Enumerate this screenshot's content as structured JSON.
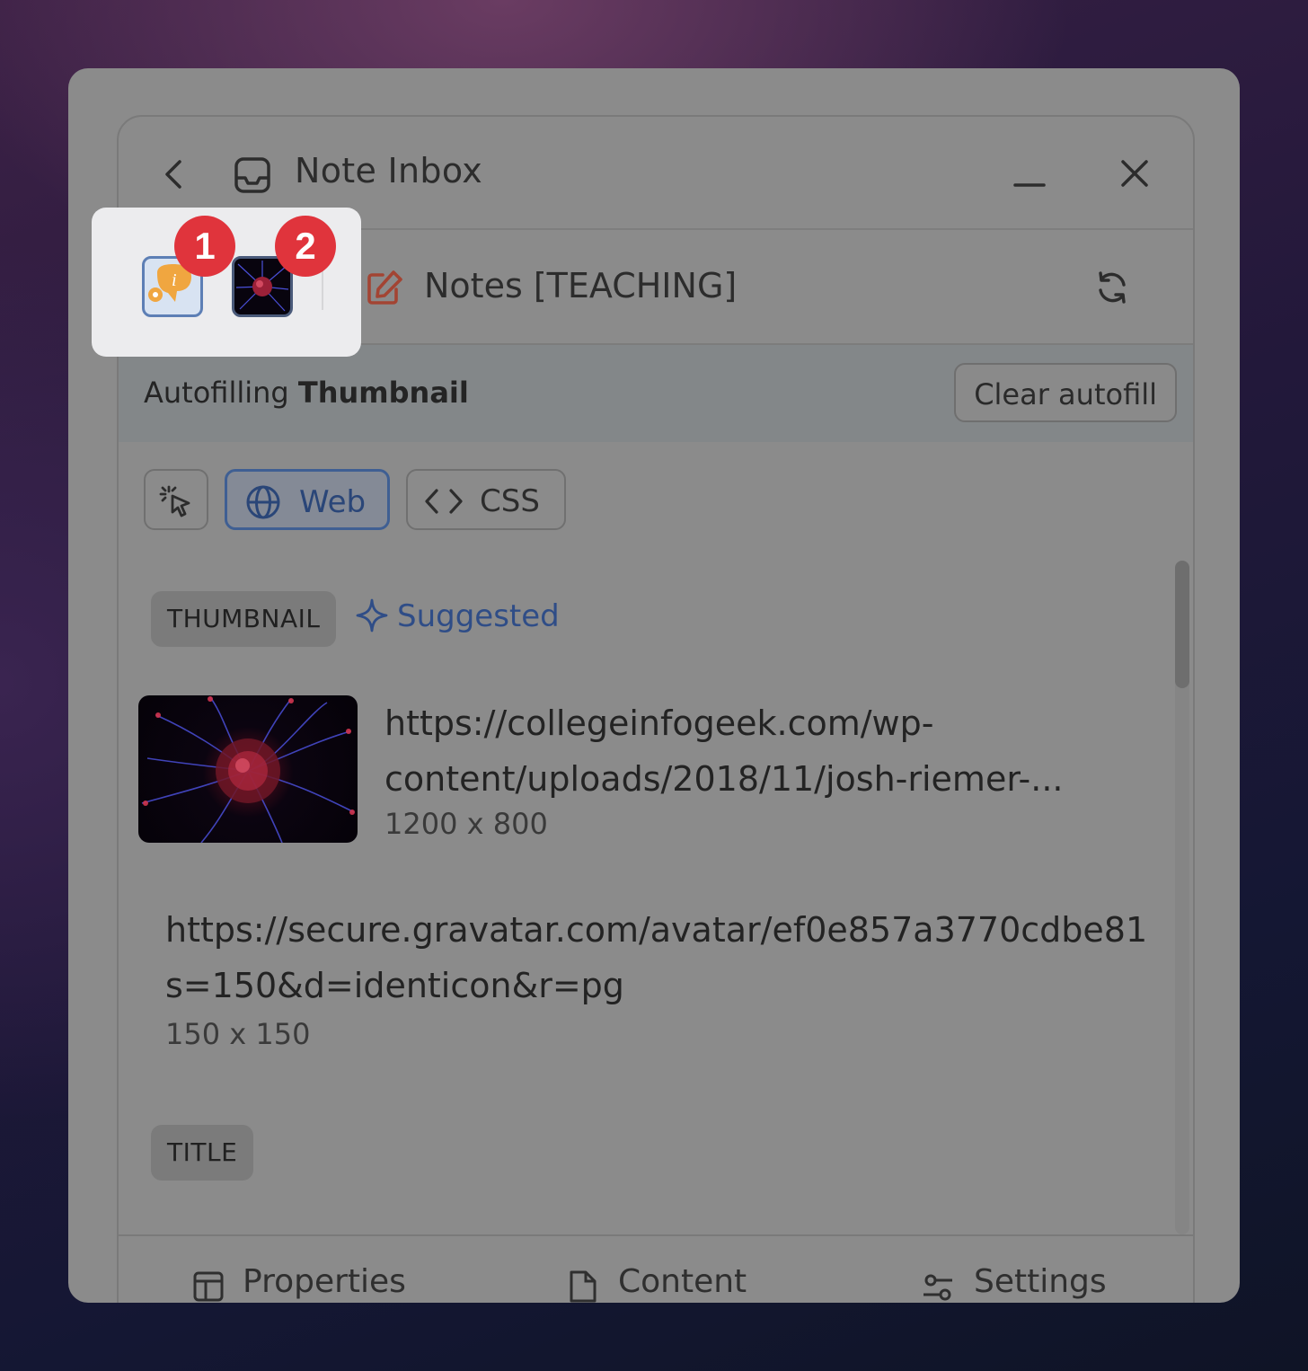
{
  "header": {
    "title": "Note Inbox"
  },
  "source": {
    "title": "Notes [TEACHING]"
  },
  "autofill": {
    "prefix": "Autofilling",
    "field": "Thumbnail",
    "clear_label": "Clear autofill"
  },
  "tools": {
    "web_label": "Web",
    "css_label": "CSS",
    "active": "Web"
  },
  "thumbnail_section": {
    "tag": "THUMBNAIL",
    "suggested_label": "Suggested",
    "items": [
      {
        "url_line1": "https://collegeinfogeek.com/wp-",
        "url_line2": "content/uploads/2018/11/josh-riemer-...",
        "dims": "1200 x 800"
      },
      {
        "url_line1": "https://secure.gravatar.com/avatar/ef0e857a3770cdbe81",
        "url_line2": "s=150&d=identicon&r=pg",
        "dims": "150 x 150"
      }
    ]
  },
  "title_section": {
    "tag": "TITLE"
  },
  "bottom_nav": [
    {
      "label": "Properties"
    },
    {
      "label": "Content"
    },
    {
      "label": "Settings"
    }
  ],
  "badges": [
    "1",
    "2"
  ],
  "colors": {
    "accent_blue": "#2f4d87",
    "badge_red": "#e0343c",
    "edit_icon": "#a34433"
  }
}
